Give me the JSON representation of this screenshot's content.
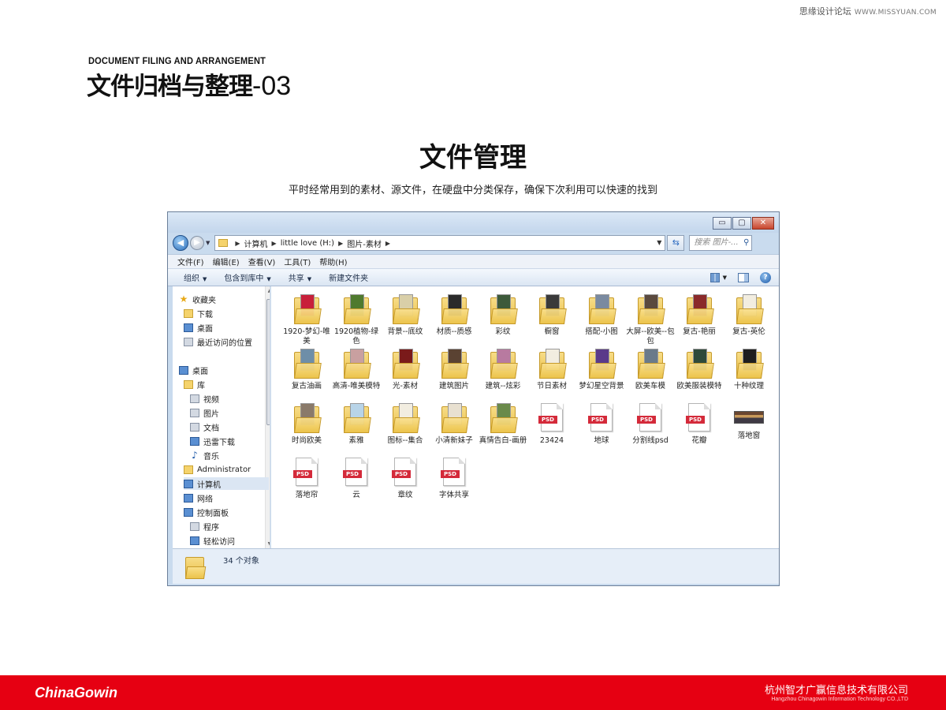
{
  "watermark": {
    "cn": "思缘设计论坛",
    "en": "WWW.MISSYUAN.COM"
  },
  "header": {
    "title_en": "DOCUMENT FILING AND ARRANGEMENT",
    "title_cn": "文件归档与整理",
    "title_num": "-03"
  },
  "section": {
    "title": "文件管理",
    "subtitle": "平时经常用到的素材、源文件，在硬盘中分类保存，确保下次利用可以快速的找到"
  },
  "explorer": {
    "window_buttons": {
      "minimize": "▭",
      "maximize": "▢",
      "close": "✕"
    },
    "address": {
      "crumbs": [
        "计算机",
        "little love (H:)",
        "图片-素材"
      ]
    },
    "search": {
      "placeholder": "搜索 图片-..."
    },
    "menu": [
      "文件(F)",
      "编辑(E)",
      "查看(V)",
      "工具(T)",
      "帮助(H)"
    ],
    "commands": [
      "组织",
      "包含到库中",
      "共享",
      "新建文件夹"
    ],
    "nav": [
      {
        "label": "收藏夹",
        "icon": "star-icon"
      },
      {
        "label": "下载",
        "icon": "download-folder-icon"
      },
      {
        "label": "桌面",
        "icon": "desktop-icon"
      },
      {
        "label": "最近访问的位置",
        "icon": "recent-places-icon"
      },
      {
        "label": "桌面",
        "icon": "desktop-icon"
      },
      {
        "label": "库",
        "icon": "library-icon"
      },
      {
        "label": "视频",
        "icon": "video-icon"
      },
      {
        "label": "图片",
        "icon": "pictures-icon"
      },
      {
        "label": "文档",
        "icon": "documents-icon"
      },
      {
        "label": "迅雷下载",
        "icon": "thunder-download-icon"
      },
      {
        "label": "音乐",
        "icon": "music-icon"
      },
      {
        "label": "Administrator",
        "icon": "user-icon"
      },
      {
        "label": "计算机",
        "icon": "computer-icon"
      },
      {
        "label": "网络",
        "icon": "network-icon"
      },
      {
        "label": "控制面板",
        "icon": "control-panel-icon"
      },
      {
        "label": "程序",
        "icon": "programs-icon"
      },
      {
        "label": "轻松访问",
        "icon": "ease-of-access-icon"
      }
    ],
    "files": [
      {
        "label": "1920-梦幻-唯美",
        "type": "folder",
        "accent": "#c8203a"
      },
      {
        "label": "1920植物-绿色",
        "type": "folder",
        "accent": "#4f7a2e"
      },
      {
        "label": "背景--底纹",
        "type": "folder",
        "accent": "#d9cfa8"
      },
      {
        "label": "材质--质感",
        "type": "folder",
        "accent": "#2a2a2a"
      },
      {
        "label": "彩纹",
        "type": "folder",
        "accent": "#3d5a3a"
      },
      {
        "label": "橱窗",
        "type": "folder",
        "accent": "#3a3a3a"
      },
      {
        "label": "搭配-小图",
        "type": "folder",
        "accent": "#7a8aa0"
      },
      {
        "label": "大屏--欧美--包包",
        "type": "folder",
        "accent": "#5a4a3e"
      },
      {
        "label": "复古-艳丽",
        "type": "folder",
        "accent": "#8a2a2a"
      },
      {
        "label": "复古-英伦",
        "type": "folder",
        "accent": "#f2ede0"
      },
      {
        "label": "复古油画",
        "type": "folder",
        "accent": "#6e8ea8"
      },
      {
        "label": "高清-唯美模特",
        "type": "folder",
        "accent": "#c9a0a0"
      },
      {
        "label": "光-素材",
        "type": "folder",
        "accent": "#7a1a1a"
      },
      {
        "label": "建筑图片",
        "type": "folder",
        "accent": "#5a4232"
      },
      {
        "label": "建筑--炫彩",
        "type": "folder",
        "accent": "#b87aa0"
      },
      {
        "label": "节日素材",
        "type": "folder",
        "accent": "#f2ede0"
      },
      {
        "label": "梦幻星空背景",
        "type": "folder",
        "accent": "#5a3a8a"
      },
      {
        "label": "欧美车模",
        "type": "folder",
        "accent": "#6a7a8a"
      },
      {
        "label": "欧美服装模特",
        "type": "folder",
        "accent": "#2e4a3a"
      },
      {
        "label": "十种纹理",
        "type": "folder",
        "accent": "#1e1e1e"
      },
      {
        "label": "时尚欧美",
        "type": "folder",
        "accent": "#8a7a6a"
      },
      {
        "label": "素雅",
        "type": "folder",
        "accent": "#b8d4e8"
      },
      {
        "label": "图标--集合",
        "type": "folder",
        "accent": "#f2ede0"
      },
      {
        "label": "小清新妹子",
        "type": "folder",
        "accent": "#e8e0d0"
      },
      {
        "label": "真情告白-画册",
        "type": "folder",
        "accent": "#6a8a4a"
      },
      {
        "label": "23424",
        "type": "psd"
      },
      {
        "label": "地球",
        "type": "psd"
      },
      {
        "label": "分割线psd",
        "type": "psd"
      },
      {
        "label": "花瓣",
        "type": "psd"
      },
      {
        "label": "落地窗",
        "type": "image"
      },
      {
        "label": "落地帘",
        "type": "psd"
      },
      {
        "label": "云",
        "type": "psd"
      },
      {
        "label": "章纹",
        "type": "psd"
      },
      {
        "label": "字体共享",
        "type": "psd"
      }
    ],
    "status": "34 个对象"
  },
  "footer": {
    "logo": "ChinaGowin",
    "company_cn": "杭州智才广赢信息技术有限公司",
    "company_en": "Hangzhou Chinagowin Information Technology CO.,LTD"
  },
  "colors": {
    "brand_red": "#e60012"
  }
}
